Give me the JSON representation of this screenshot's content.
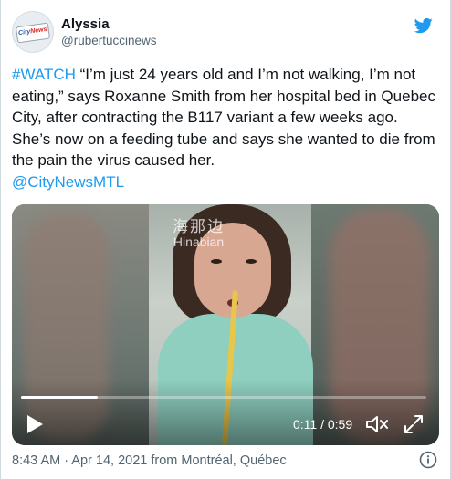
{
  "author": {
    "display_name": "Alyssia",
    "handle": "@rubertuccinews",
    "avatar_text_a": "City",
    "avatar_text_b": "News"
  },
  "tweet": {
    "hashtag": "#WATCH",
    "text": " “I’m just 24 years old and I’m not walking, I’m not eating,” says Roxanne Smith from her hospital bed in Quebec City, after contracting the B117 variant a few weeks ago. She’s now on a feeding tube and says she wanted to die from the pain the virus caused her.",
    "mention": "@CityNewsMTL"
  },
  "video": {
    "watermark_cn": "海那边",
    "watermark_en": "Hinabian",
    "time_display": "0:11 / 0:59",
    "progress_fraction": 0.19
  },
  "footer": {
    "meta": "8:43 AM · Apr 14, 2021 from Montréal, Québec"
  },
  "icons": {
    "logo": "twitter-bird-icon",
    "play": "play-icon",
    "volume": "volume-icon",
    "fullscreen": "fullscreen-icon",
    "info": "info-icon"
  },
  "colors": {
    "accent": "#1d9bf0",
    "text": "#0f1419",
    "muted": "#536471"
  }
}
